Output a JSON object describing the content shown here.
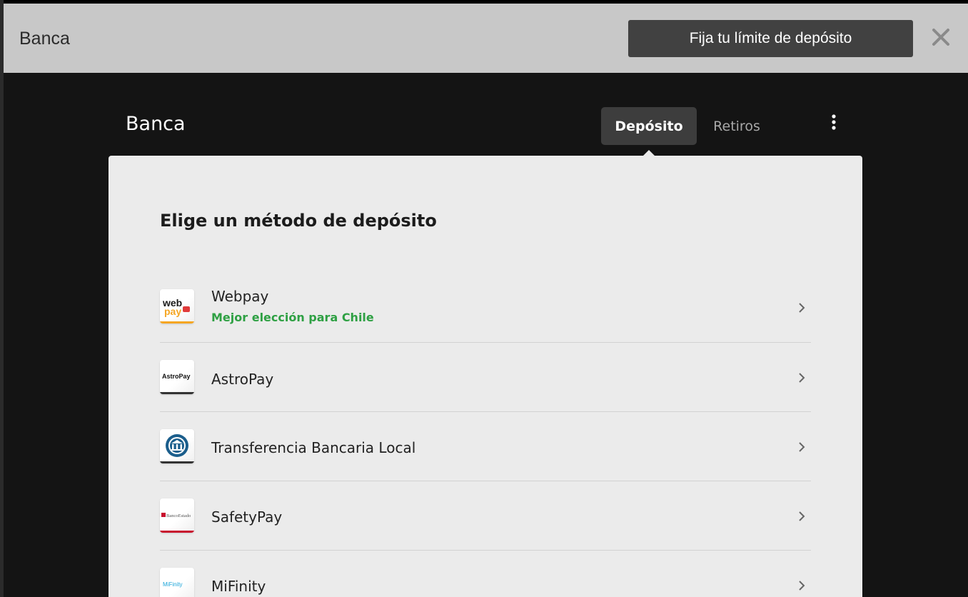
{
  "header": {
    "title": "Banca",
    "limit_button_label": "Fija tu límite de depósito"
  },
  "section": {
    "title": "Banca",
    "tabs": [
      {
        "label": "Depósito",
        "active": true
      },
      {
        "label": "Retiros",
        "active": false
      }
    ]
  },
  "card": {
    "title": "Elige un método de depósito",
    "methods": [
      {
        "name": "Webpay",
        "subtitle": "Mejor elección para Chile",
        "logo": "webpay-logo",
        "accent": "#f5a623"
      },
      {
        "name": "AstroPay",
        "subtitle": "",
        "logo": "astropay-logo",
        "accent": "#333333"
      },
      {
        "name": "Transferencia Bancaria Local",
        "subtitle": "",
        "logo": "bank-icon",
        "accent": "#333333"
      },
      {
        "name": "SafetyPay",
        "subtitle": "",
        "logo": "bancoestado-logo",
        "accent": "#c8102e"
      },
      {
        "name": "MiFinity",
        "subtitle": "",
        "logo": "mifinity-logo",
        "accent": "#1fa6d9"
      }
    ],
    "logo_texts": {
      "webpay_a": "web",
      "webpay_b": "pay",
      "astropay": "AstroPay",
      "bancoestado": "BancoEstado",
      "mifinity": "MiFinity"
    }
  },
  "colors": {
    "background": "#141414",
    "header_bg": "#c8c8c8",
    "card_bg": "#ebebeb",
    "highlight": "#2ea043"
  }
}
